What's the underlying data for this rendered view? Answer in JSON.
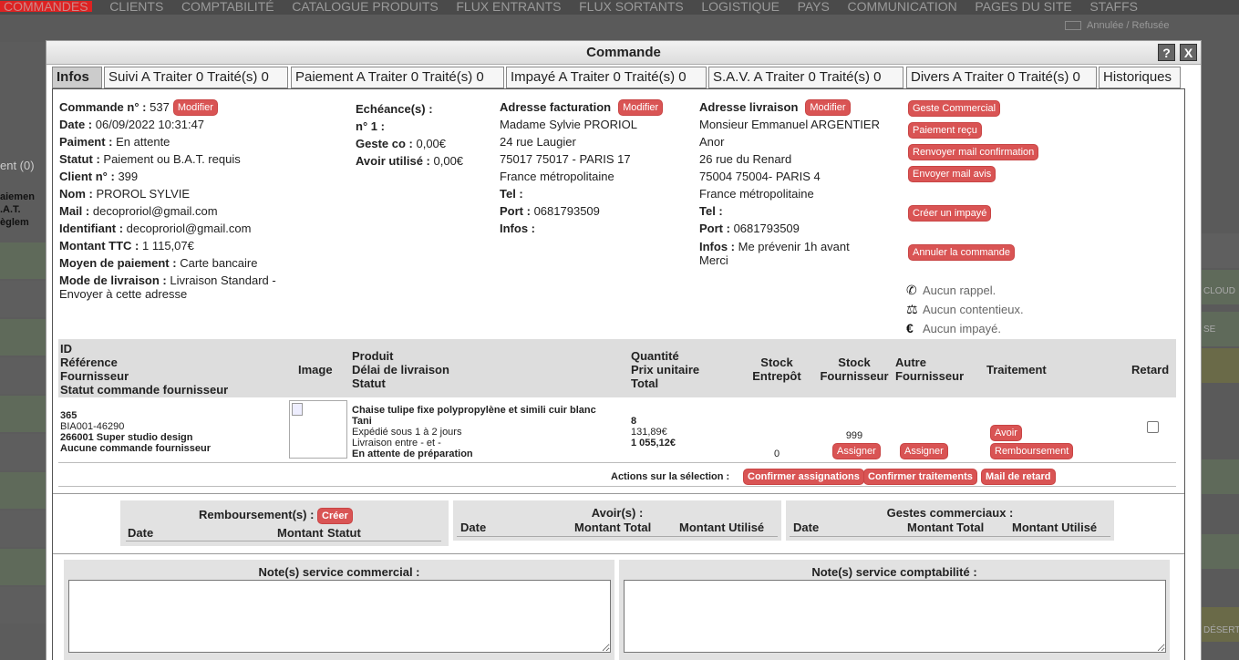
{
  "background": {
    "nav_items": [
      "COMMANDES",
      "CLIENTS",
      "COMPTABILITÉ",
      "CATALOGUE PRODUITS",
      "FLUX ENTRANTS",
      "FLUX SORTANTS",
      "LOGISTIQUE",
      "PAYS",
      "COMMUNICATION",
      "PAGES DU SITE",
      "STAFFS"
    ],
    "top_right_label": "Annulée / Refusée",
    "left_labels": [
      "ent (0)",
      "aiemen",
      ".A.T.",
      "èglem"
    ],
    "right_labels": [
      "CLOUD",
      "SE",
      "DÉSERT"
    ]
  },
  "dialog": {
    "title": "Commande",
    "help_label": "?",
    "close_label": "X"
  },
  "tabs": [
    {
      "label": "Infos"
    },
    {
      "label": "Suivi A Traiter 0 Traité(s) 0"
    },
    {
      "label": "Paiement A Traiter 0 Traité(s) 0"
    },
    {
      "label": "Impayé A Traiter 0 Traité(s) 0"
    },
    {
      "label": "S.A.V. A Traiter 0 Traité(s) 0"
    },
    {
      "label": "Divers A Traiter 0 Traité(s) 0"
    },
    {
      "label": "Historiques"
    }
  ],
  "order": {
    "number_label": "Commande n° :",
    "number": "537",
    "modify_label": "Modifier",
    "date_label": "Date :",
    "date": "06/09/2022 10:31:47",
    "payment_label": "Paiment :",
    "payment": "En attente",
    "status_label": "Statut :",
    "status": "Paiement ou B.A.T. requis",
    "client_label": "Client n° :",
    "client": "399",
    "name_label": "Nom :",
    "name": "PROROL SYLVIE",
    "mail_label": "Mail :",
    "mail": "decoproriol@gmail.com",
    "login_label": "Identifiant :",
    "login": "decoproriol@gmail.com",
    "amount_label": "Montant TTC :",
    "amount": "1 115,07€",
    "method_label": "Moyen de paiement :",
    "method": "Carte bancaire",
    "delivery_label": "Mode de livraison :",
    "delivery_1": "Livraison Standard -",
    "delivery_2": "Envoyer à cette adresse"
  },
  "echeance": {
    "title": "Echéance(s) :",
    "n1_label": "n° 1 :",
    "geste_label": "Geste co :",
    "geste": "0,00€",
    "avoir_label": "Avoir utilisé :",
    "avoir": "0,00€"
  },
  "billing": {
    "title": "Adresse facturation",
    "modify_label": "Modifier",
    "line1": "Madame Sylvie PRORIOL",
    "line2": "24 rue Laugier",
    "line3": "75017 75017 - PARIS 17",
    "line4": "France métropolitaine",
    "tel_label": "Tel :",
    "port_label": "Port :",
    "port": "0681793509",
    "infos_label": "Infos :"
  },
  "shipping": {
    "title": "Adresse livraison",
    "modify_label": "Modifier",
    "line1": "Monsieur Emmanuel ARGENTIER",
    "line2": "Anor",
    "line3": "26 rue du Renard",
    "line4": "75004 75004- PARIS 4",
    "line5": "France métropolitaine",
    "tel_label": "Tel :",
    "port_label": "Port :",
    "port": "0681793509",
    "infos_label": "Infos :",
    "infos_1": "Me prévenir 1h avant",
    "infos_2": "Merci"
  },
  "actions": {
    "geste": "Geste Commercial",
    "paiement": "Paiement reçu",
    "renvoyer": "Renvoyer mail confirmation",
    "envoyer": "Envoyer mail avis",
    "impaye": "Créer un impayé",
    "annuler": "Annuler la commande"
  },
  "status_lines": {
    "rappel": "Aucun rappel.",
    "contentieux": "Aucun contentieux.",
    "impaye": "Aucun impayé."
  },
  "table": {
    "headers": {
      "id": "ID",
      "ref": "Référence",
      "fournisseur": "Fournisseur",
      "statut_cmd": "Statut commande fournisseur",
      "image": "Image",
      "produit": "Produit",
      "delai": "Délai de livraison",
      "statut": "Statut",
      "quantite": "Quantité",
      "prix": "Prix unitaire",
      "total": "Total",
      "stock_ent_1": "Stock",
      "stock_ent_2": "Entrepôt",
      "stock_four_1": "Stock",
      "stock_four_2": "Fournisseur",
      "autre_1": "Autre",
      "autre_2": "Fournisseur",
      "traitement": "Traitement",
      "retard": "Retard"
    },
    "row": {
      "id": "365",
      "ref": "BIA001-46290",
      "fournisseur": "266001 Super studio design",
      "statut_cmd": "Aucune commande fournisseur",
      "produit": "Chaise tulipe fixe polypropylène et simili cuir blanc",
      "produit_2": "Tani",
      "expedie": "Expédié sous 1 à 2 jours",
      "livraison": "Livraison entre - et -",
      "statut": "En attente de préparation",
      "quantite": "8",
      "prix": "131,89€",
      "total": "1 055,12€",
      "stock_entrepot": "0",
      "stock_fournisseur": "999",
      "assigner_1": "Assigner",
      "assigner_2": "Assigner",
      "avoir": "Avoir",
      "remboursement": "Remboursement"
    },
    "selection_label": "Actions sur la sélection :",
    "confirm_assign": "Confirmer assignations",
    "confirm_trait": "Confirmer traitements",
    "mail_retard": "Mail de retard"
  },
  "remboursement": {
    "title": "Remboursement(s) :",
    "create": "Créer",
    "col_date": "Date",
    "col_montant": "Montant",
    "col_statut": "Statut"
  },
  "avoirs": {
    "title": "Avoir(s) :",
    "col_date": "Date",
    "col_total": "Montant Total",
    "col_utilise": "Montant Utilisé"
  },
  "gestes": {
    "title": "Gestes commerciaux :",
    "col_date": "Date",
    "col_total": "Montant Total",
    "col_utilise": "Montant Utilisé"
  },
  "notes": {
    "commercial": "Note(s) service commercial :",
    "compta": "Note(s) service comptabilité :"
  }
}
